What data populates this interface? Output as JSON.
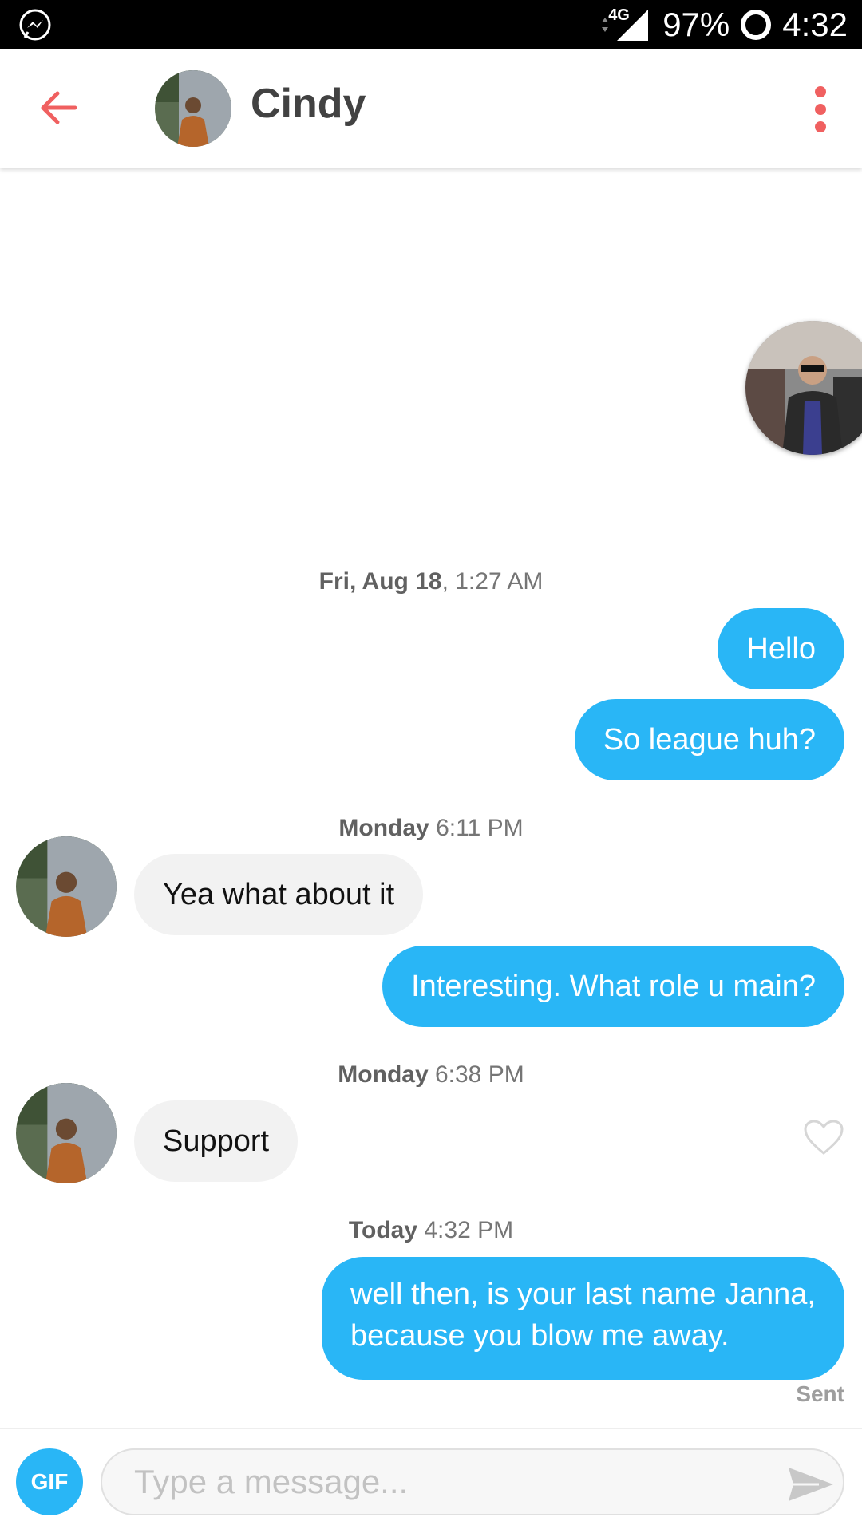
{
  "status_bar": {
    "network": "4G",
    "battery": "97%",
    "time": "4:32"
  },
  "header": {
    "contact_name": "Cindy"
  },
  "messages": [
    {
      "type": "timestamp",
      "day": "Fri, Aug 18",
      "time": ", 1:27 AM"
    },
    {
      "type": "out",
      "text": "Hello"
    },
    {
      "type": "out",
      "text": "So league huh?"
    },
    {
      "type": "timestamp",
      "day": "Monday",
      "time": " 6:11 PM"
    },
    {
      "type": "in",
      "text": "Yea what about it"
    },
    {
      "type": "out",
      "text": "Interesting. What role u main?"
    },
    {
      "type": "timestamp",
      "day": "Monday",
      "time": " 6:38 PM"
    },
    {
      "type": "in",
      "text": "Support"
    },
    {
      "type": "timestamp",
      "day": "Today",
      "time": " 4:32 PM"
    },
    {
      "type": "out",
      "line1": "well then, is your last name Janna,",
      "line2": "because you blow me away."
    }
  ],
  "sent_label": "Sent",
  "composer": {
    "gif_label": "GIF",
    "placeholder": "Type a message..."
  },
  "colors": {
    "accent_blue": "#29b6f6",
    "accent_red": "#f06060",
    "incoming_bubble": "#f2f2f2"
  },
  "icons": [
    "messenger-icon",
    "signal-icon",
    "battery-icon",
    "back-arrow-icon",
    "more-vert-icon",
    "heart-icon",
    "send-icon"
  ]
}
